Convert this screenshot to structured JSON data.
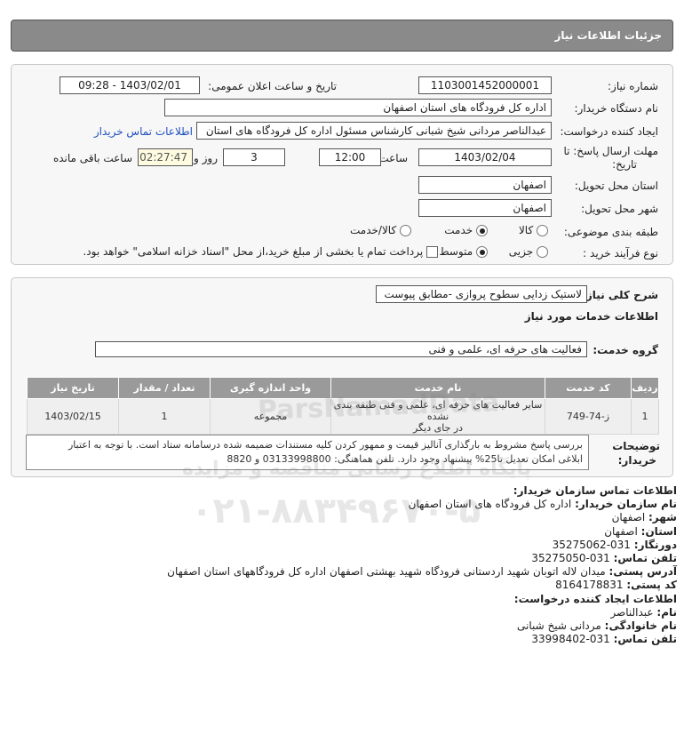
{
  "header": {
    "title": "جزئیات اطلاعات نیاز"
  },
  "info": {
    "need_number_label": "شماره نیاز:",
    "need_number": "1103001452000001",
    "announce_label": "تاریخ و ساعت اعلان عمومی:",
    "announce_value": "1403/02/01 - 09:28",
    "buyer_org_label": "نام دستگاه خریدار:",
    "buyer_org": "اداره کل فرودگاه های استان اصفهان",
    "creator_label": "ایجاد کننده درخواست:",
    "creator": "عبدالناصر مردانی شیخ شبانی کارشناس مسئول  اداره کل فرودگاه های استان",
    "contact_link": "اطلاعات تماس خریدار",
    "deadline_label_1": "مهلت ارسال پاسخ: تا",
    "deadline_label_2": "تاریخ:",
    "deadline_date": "1403/02/04",
    "time_label": "ساعت",
    "deadline_time": "12:00",
    "days": "3",
    "days_label": "روز و",
    "remaining": "02:27:47",
    "remaining_label": "ساعت باقی مانده",
    "province_label": "استان محل تحویل:",
    "province": "اصفهان",
    "city_label": "شهر محل تحویل:",
    "city": "اصفهان",
    "category_label": "طبقه بندی موضوعی:",
    "category_options": [
      "کالا",
      "خدمت",
      "کالا/خدمت"
    ],
    "process_label": "نوع فرآیند خرید :",
    "process_options": [
      "جزیی",
      "متوسط"
    ],
    "treasury_note": "پرداخت تمام یا بخشی از مبلغ خرید،از محل \"اسناد خزانه اسلامی\" خواهد بود."
  },
  "details": {
    "summary_label": "شرح کلی نیاز:",
    "summary": "لاستیک زدایی سطوح پروازی -مطابق پیوست",
    "services_title": "اطلاعات خدمات مورد نیاز",
    "service_group_label": "گروه خدمت:",
    "service_group": "فعالیت های حرفه ای، علمی و فنی",
    "table_headers": [
      "ردیف",
      "کد خدمت",
      "نام خدمت",
      "واحد اندازه گیری",
      "تعداد / مقدار",
      "تاریخ نیاز"
    ],
    "row": {
      "index": "1",
      "code": "ز-74-749",
      "name_line1": "سایر فعالیت های حرفه ای، علمی و فنی طبقه بندی نشده",
      "name_line2": "در جای دیگر",
      "unit": "مجموعه",
      "qty": "1",
      "date": "1403/02/15"
    },
    "notes_label_1": "توضیحات",
    "notes_label_2": "خریدار:",
    "notes_line1": "بررسی پاسخ مشروط به بارگذاری آنالیز قیمت و ممهور کردن کلیه مستندات ضمیمه شده درسامانه ستاد است. با توجه به اعتبار",
    "notes_line2": "ابلاغی امکان تعدیل تا25% پیشنهاد وجود دارد. تلفن هماهنگی: 03133998800 و 8820"
  },
  "contact": {
    "org_title": "اطلاعات تماس سازمان خریدار:",
    "org_name_k": "نام سازمان خریدار:",
    "org_name_v": "اداره کل فرودگاه های استان اصفهان",
    "city_k": "شهر:",
    "city_v": "اصفهان",
    "province_k": "استان:",
    "province_v": "اصفهان",
    "fax_k": "دورنگار:",
    "fax_v": "031-35275062",
    "phone_k": "تلفن تماس:",
    "phone_v": "031-35275050",
    "address_k": "آدرس پستی:",
    "address_v": "میدان لاله اتوبان شهید اردستانی فرودگاه شهید بهشتی اصفهان اداره کل فرودگاههای استان اصفهان",
    "postal_k": "کد پستی:",
    "postal_v": "8164178831",
    "creator_title": "اطلاعات ایجاد کننده درخواست:",
    "first_k": "نام:",
    "first_v": "عبدالناصر",
    "last_k": "نام خانوادگی:",
    "last_v": "مردانی شیخ شبانی",
    "cphone_k": "تلفن تماس:",
    "cphone_v": "031-33998402"
  },
  "watermark": {
    "phone": "۰۲۱-۸۸۳۴۹۶۷۰-۵",
    "slogan": "پایگاه اطلاع رسانی مناقصه و مزایده",
    "brand": "ParsNamadData"
  }
}
